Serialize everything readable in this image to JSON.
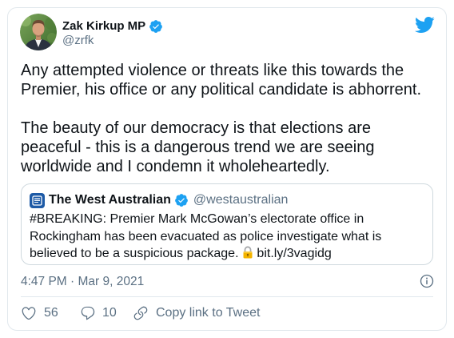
{
  "colors": {
    "text": "#0f1419",
    "muted": "#5b7083",
    "accent": "#1da1f2",
    "border": "#e1e8ed",
    "quote_border": "#cfd9de",
    "background": "#ffffff"
  },
  "author": {
    "name": "Zak Kirkup MP",
    "handle": "@zrfk",
    "verified": true,
    "avatar_icon": "avatar-photo",
    "badge_icon": "verified-badge-icon"
  },
  "brand_icon": "twitter-bird-icon",
  "tweet": {
    "paragraphs": [
      {
        "lines": [
          "Any attempted violence or threats like this towards the",
          "Premier, his office or any political candidate is abhorrent."
        ]
      },
      {
        "lines": [
          "The beauty of our democracy is that elections are",
          "peaceful - this is a dangerous trend we are seeing",
          "worldwide and I condemn it wholeheartedly."
        ]
      }
    ]
  },
  "quoted_tweet": {
    "name": "The West Australian",
    "handle": "@westaustralian",
    "verified": true,
    "avatar_icon": "west-australian-logo",
    "lines": [
      "#BREAKING: Premier Mark McGowan’s electorate office in",
      "Rockingham has been evacuated as police investigate what is",
      "believed to be a suspicious package."
    ],
    "emoji_icon": "lock-icon",
    "link": "bit.ly/3vagidg"
  },
  "meta": {
    "timestamp": "4:47 PM · Mar 9, 2021",
    "info_icon": "info-icon"
  },
  "actions": {
    "like": {
      "icon": "heart-icon",
      "count": "56"
    },
    "reply": {
      "icon": "reply-icon",
      "count": "10"
    },
    "copy_link": {
      "icon": "link-icon",
      "label": "Copy link to Tweet"
    }
  }
}
